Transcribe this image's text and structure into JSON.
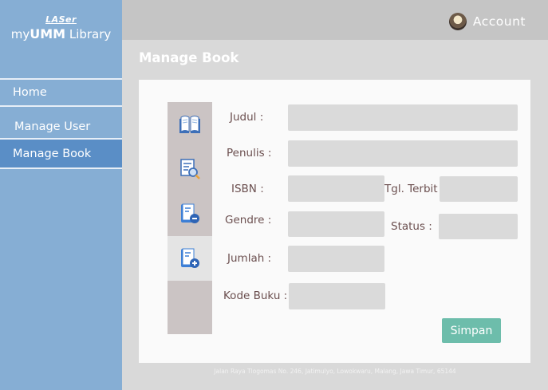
{
  "brand": {
    "top": "LASer",
    "main_prefix": "my",
    "main_bold": "UMM",
    "main_suffix": " Library"
  },
  "nav": [
    {
      "label": "Home"
    },
    {
      "label": "Manage User"
    },
    {
      "label": "Manage Book",
      "active": true
    }
  ],
  "header": {
    "account_label": "Account",
    "avatar_icon": "avatar"
  },
  "page": {
    "title": "Manage Book"
  },
  "form": {
    "judul_label": "Judul :",
    "penulis_label": "Penulis :",
    "isbn_label": "ISBN :",
    "tgl_terbit_label": "Tgl. Terbit :",
    "gendre_label": "Gendre :",
    "status_label": "Status :",
    "jumlah_label": "Jumlah :",
    "kode_buku_label": "Kode Buku :",
    "submit_label": "Simpan",
    "values": {
      "judul": "",
      "penulis": "",
      "isbn": "",
      "tgl_terbit": "",
      "gendre": "",
      "status": "",
      "jumlah": "",
      "kode_buku": ""
    }
  },
  "icons": [
    "open-book-icon",
    "search-document-icon",
    "remove-book-icon",
    "add-book-icon"
  ],
  "colors": {
    "sidebar": "#86aed4",
    "nav_active": "#5a8ec6",
    "button": "#6dbdab",
    "label": "#6b4f4f"
  },
  "footer": {
    "address": "Jalan Raya Tlogomas No. 246, Jatimulyo, Lowokwaru, Malang, Jawa Timur, 65144"
  }
}
